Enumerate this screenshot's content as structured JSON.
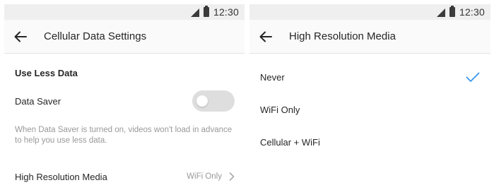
{
  "status_bar": {
    "time": "12:30"
  },
  "left_screen": {
    "title": "Cellular Data Settings",
    "section_header": "Use Less Data",
    "data_saver": {
      "label": "Data Saver",
      "enabled": false,
      "description": "When Data Saver is turned on, videos won't load in advance to help you use less data."
    },
    "high_res_row": {
      "label": "High Resolution Media",
      "value": "WiFi Only"
    }
  },
  "right_screen": {
    "title": "High Resolution Media",
    "options": [
      {
        "label": "Never",
        "selected": true
      },
      {
        "label": "WiFi Only",
        "selected": false
      },
      {
        "label": "Cellular + WiFi",
        "selected": false
      }
    ]
  },
  "colors": {
    "accent": "#3897f0",
    "text": "#262626",
    "secondary_text": "#999999",
    "toggle_off": "#dedede",
    "status_bar_bg": "#efefef"
  },
  "icons": [
    "signal-icon",
    "battery-icon",
    "back-arrow-icon",
    "chevron-right-icon",
    "checkmark-icon"
  ]
}
